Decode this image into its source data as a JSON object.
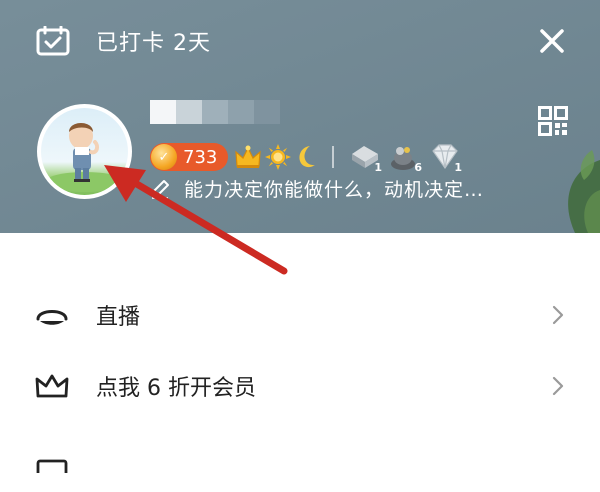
{
  "header": {
    "checkin_label": "已打卡 2天",
    "level": "733",
    "motto": "能力决定你能做什么，动机决定…",
    "medals": [
      {
        "icon": "silver-medal-icon",
        "count": "1"
      },
      {
        "icon": "dark-medal-icon",
        "count": "6"
      },
      {
        "icon": "diamond-medal-icon",
        "count": "1"
      }
    ]
  },
  "menu": {
    "items": [
      {
        "label": "直播",
        "icon": "live-icon"
      },
      {
        "label": "点我 6 折开会员",
        "icon": "crown-icon"
      }
    ]
  },
  "colors": {
    "header_bg": "#6f8793",
    "level_badge": "#e85a2a",
    "arrow": "#cc2a22"
  }
}
